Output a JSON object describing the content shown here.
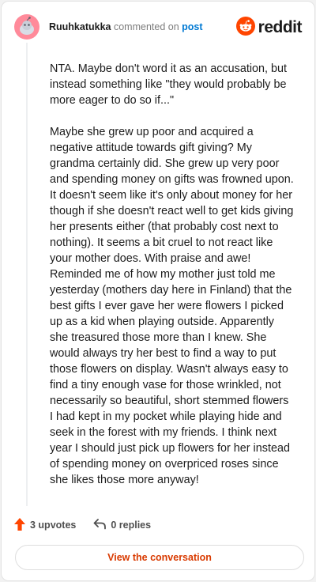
{
  "header": {
    "username": "Ruuhkatukka",
    "action_text": "commented on",
    "post_link": "post",
    "brand": "reddit"
  },
  "comment": {
    "paragraphs": [
      "NTA. Maybe don't word it as an accusation, but instead something like \"they would probably be more eager to do so if...\"",
      "Maybe she grew up poor and acquired a negative attitude towards gift giving? My grandma certainly did. She grew up very poor and spending money on gifts was frowned upon. It doesn't seem like it's only about money for her though if she doesn't react well to get kids giving her presents either (that probably cost next to nothing). It seems a bit cruel to not react like your mother does. With praise and awe! Reminded me of how my mother just told me yesterday (mothers day here in Finland) that the best gifts I ever gave her were flowers I picked up as a kid when playing outside. Apparently she treasured those more than I knew. She would always try her best to find a way to put those flowers on display. Wasn't always easy to find a tiny enough vase for those wrinkled, not necessarily so beautiful, short stemmed flowers I had kept in my pocket while playing hide and seek in the forest with my friends. I think next year I should just pick up flowers for her instead of spending money on overpriced roses since she likes those more anyway!"
    ]
  },
  "actions": {
    "upvotes": "3 upvotes",
    "replies": "0 replies"
  },
  "view_button": "View the conversation",
  "colors": {
    "brand_orange": "#ff4500",
    "link_blue": "#0079d3",
    "button_text": "#d93a00",
    "avatar_pink": "#ff8a9a"
  },
  "icons": {
    "avatar": "snoo-avatar-icon",
    "brand": "reddit-logo-icon",
    "upvote": "upvote-arrow-icon",
    "reply": "reply-arrow-icon"
  }
}
